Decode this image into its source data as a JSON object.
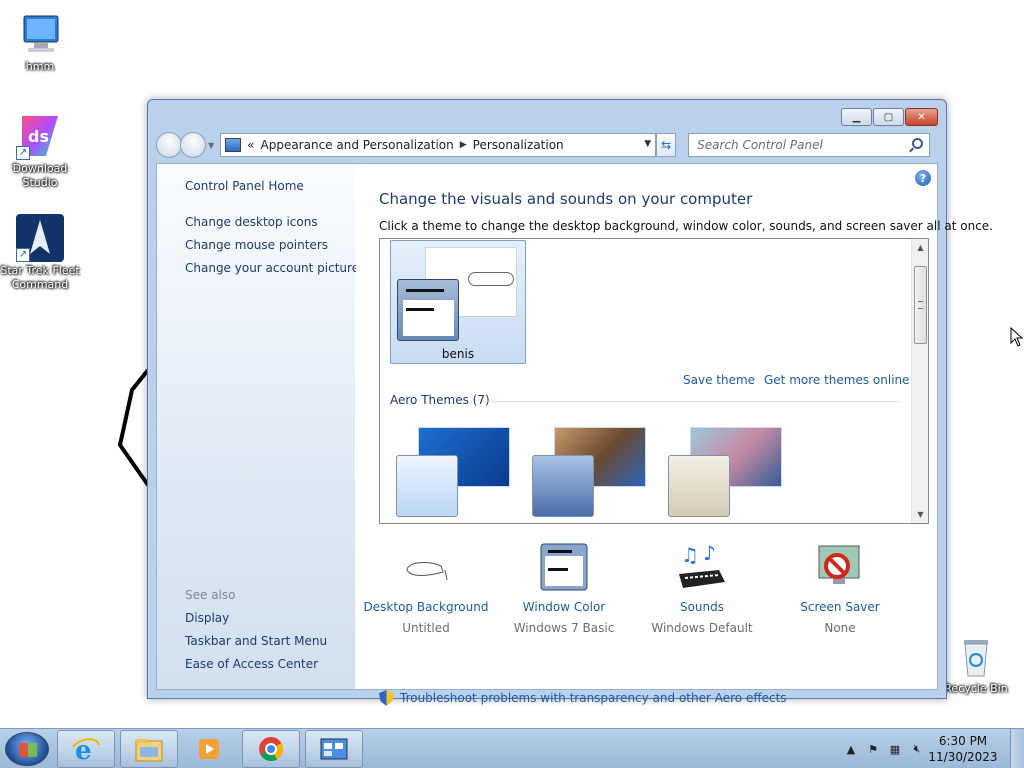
{
  "desktop": {
    "icons": [
      {
        "label": "hmm",
        "icon": "computer-icon"
      },
      {
        "label": "Download Studio",
        "icon": "download-studio-icon"
      },
      {
        "label": "Star Trek Fleet Command",
        "icon": "star-trek-icon"
      },
      {
        "label": "Recycle Bin",
        "icon": "recycle-bin-icon"
      }
    ]
  },
  "window": {
    "address": {
      "chevron": "«",
      "crumb1": "Appearance and Personalization",
      "crumb2": "Personalization"
    },
    "search_placeholder": "Search Control Panel",
    "sidebar": {
      "home": "Control Panel Home",
      "links": [
        "Change desktop icons",
        "Change mouse pointers",
        "Change your account picture"
      ],
      "see_also_title": "See also",
      "see_also": [
        "Display",
        "Taskbar and Start Menu",
        "Ease of Access Center"
      ]
    },
    "main": {
      "title": "Change the visuals and sounds on your computer",
      "description": "Click a theme to change the desktop background, window color, sounds, and screen saver all at once.",
      "my_theme_name": "benis",
      "save_theme": "Save theme",
      "more_themes": "Get more themes online",
      "aero_heading": "Aero Themes (7)",
      "bottom": [
        {
          "title": "Desktop Background",
          "sub": "Untitled"
        },
        {
          "title": "Window Color",
          "sub": "Windows 7 Basic"
        },
        {
          "title": "Sounds",
          "sub": "Windows Default"
        },
        {
          "title": "Screen Saver",
          "sub": "None"
        }
      ],
      "troubleshoot": "Troubleshoot problems with transparency and other Aero effects"
    }
  },
  "taskbar": {
    "clock_time": "6:30 PM",
    "clock_date": "11/30/2023"
  },
  "colors": {
    "link": "#1e5ba8",
    "heading": "#1e3a6e"
  }
}
